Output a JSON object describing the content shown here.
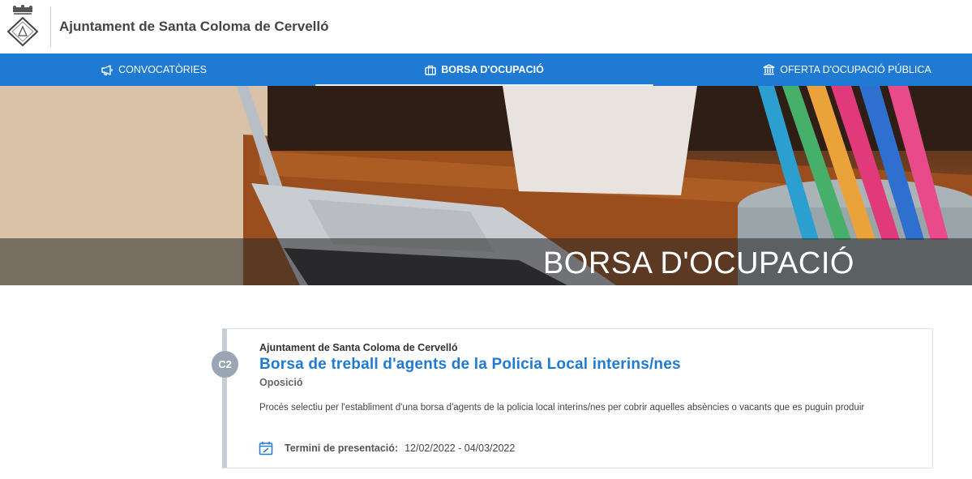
{
  "header": {
    "title": "Ajuntament de Santa Coloma de Cervelló"
  },
  "nav": {
    "items": [
      {
        "label": "CONVOCATÒRIES",
        "icon": "megaphone-icon",
        "active": false
      },
      {
        "label": "BORSA D'OCUPACIÓ",
        "icon": "briefcase-icon",
        "active": true
      },
      {
        "label": "OFERTA D'OCUPACIÓ PÚBLICA",
        "icon": "institution-icon",
        "active": false
      }
    ]
  },
  "hero": {
    "title": "BORSA D'OCUPACIÓ"
  },
  "listing": {
    "badge": "C2",
    "organization": "Ajuntament de Santa Coloma de Cervelló",
    "title": "Borsa de treball d'agents de la Policia Local interins/nes",
    "type": "Oposició",
    "description": "Procés selectiu per l'establiment d'una borsa d'agents de la policia local interins/nes per cobrir aquelles absències o vacants que es puguin produir",
    "deadline_label": "Termini de presentació:",
    "deadline_value": "12/02/2022 - 04/03/2022"
  },
  "colors": {
    "nav_blue": "#1f7ad4",
    "title_blue": "#1f7ad4",
    "badge_gray": "#9aa6b3"
  }
}
